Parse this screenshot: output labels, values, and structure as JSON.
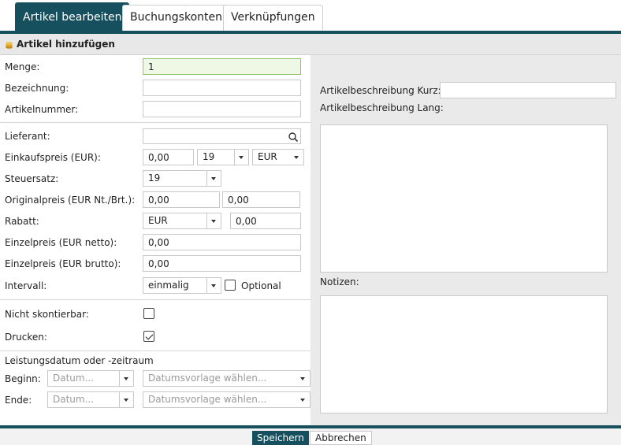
{
  "tabs": [
    {
      "label": "Artikel bearbeiten",
      "active": true
    },
    {
      "label": "Buchungskonten",
      "active": false
    },
    {
      "label": "Verknüpfungen",
      "active": false
    }
  ],
  "section": {
    "title": "Artikel hinzufügen",
    "icon": "coins-icon"
  },
  "form": {
    "menge": {
      "label": "Menge:",
      "value": "1"
    },
    "bezeichnung": {
      "label": "Bezeichnung:",
      "value": ""
    },
    "artikelnummer": {
      "label": "Artikelnummer:",
      "value": ""
    },
    "lieferant": {
      "label": "Lieferant:",
      "value": "",
      "icon": "search-icon"
    },
    "einkaufspreis": {
      "label": "Einkaufspreis (EUR):",
      "value": "0,00",
      "tax": "19",
      "currency": "EUR"
    },
    "steuersatz": {
      "label": "Steuersatz:",
      "value": "19"
    },
    "originalpreis": {
      "label": "Originalpreis (EUR Nt./Brt.):",
      "netto": "0,00",
      "brutto": "0,00"
    },
    "rabatt": {
      "label": "Rabatt:",
      "type": "EUR",
      "value": "0,00"
    },
    "einzelpreis_netto": {
      "label": "Einzelpreis (EUR netto):",
      "value": "0,00"
    },
    "einzelpreis_brutto": {
      "label": "Einzelpreis (EUR brutto):",
      "value": "0,00"
    },
    "intervall": {
      "label": "Intervall:",
      "value": "einmalig",
      "optional_label": "Optional",
      "optional_checked": false
    },
    "nicht_skontierbar": {
      "label": "Nicht skontierbar:",
      "checked": false
    },
    "drucken": {
      "label": "Drucken:",
      "checked": true
    },
    "leistung": {
      "heading": "Leistungsdatum oder -zeitraum",
      "beginn_label": "Beginn:",
      "ende_label": "Ende:",
      "date_placeholder": "Datum...",
      "vorlage_placeholder": "Datumsvorlage wählen..."
    }
  },
  "right": {
    "kurz_label": "Artikelbeschreibung Kurz:",
    "kurz_value": "",
    "lang_label": "Artikelbeschreibung Lang:",
    "notizen_label": "Notizen:"
  },
  "footer": {
    "save_label": "Speichern",
    "cancel_label": "Abbrechen"
  },
  "colors": {
    "accent": "#16505e",
    "panel_bg": "#eaeaea",
    "highlight_input": "#eef8e4"
  }
}
